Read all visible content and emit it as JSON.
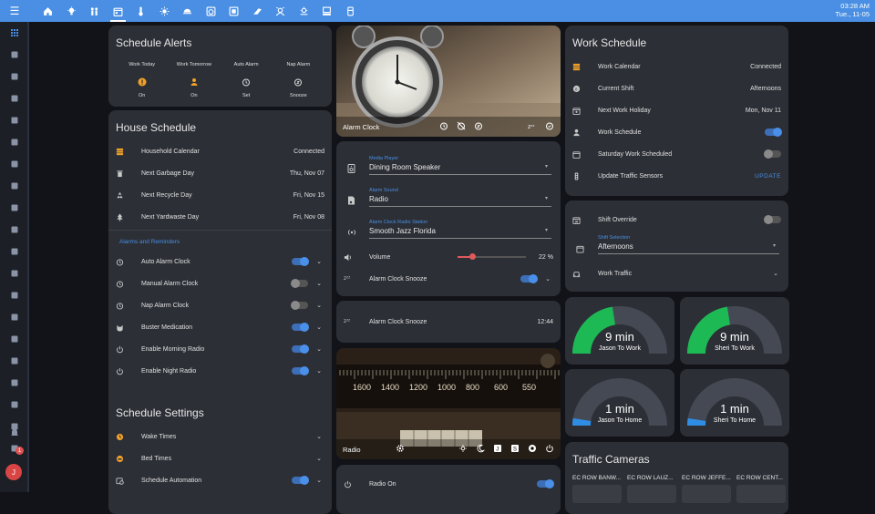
{
  "topbar": {
    "tabs": [
      "home",
      "lightbulb",
      "people",
      "calendar",
      "thermometer",
      "weather",
      "lamp",
      "washer",
      "tablet",
      "vacuum",
      "doorbell",
      "sun-cloud",
      "printer",
      "trashcan"
    ],
    "active_tab": 3,
    "time": "03:28 AM",
    "date": "Tue., 11-05"
  },
  "sidebar": {
    "items": [
      "dashboard",
      "logbook",
      "list",
      "history",
      "shield",
      "code",
      "wrench",
      "speed",
      "log",
      "calendar-grid",
      "brackets",
      "network",
      "cloud-server",
      "cloud",
      "file-code",
      "hammer",
      "router",
      "stats",
      "storage",
      "settings"
    ],
    "notification_count": "1",
    "avatar_initial": "J"
  },
  "schedule_alerts": {
    "title": "Schedule Alerts",
    "items": [
      {
        "label": "Work Today",
        "state": "On",
        "icon": "warning-icon"
      },
      {
        "label": "Work Tomorrow",
        "state": "On",
        "icon": "person-icon"
      },
      {
        "label": "Auto Alarm",
        "state": "Set",
        "icon": "alarm-icon"
      },
      {
        "label": "Nap Alarm",
        "state": "Snooze",
        "icon": "snooze-icon"
      }
    ]
  },
  "house_schedule": {
    "title": "House Schedule",
    "rows": [
      {
        "label": "Household Calendar",
        "value": "Connected"
      },
      {
        "label": "Next Garbage Day",
        "value": "Thu, Nov 07"
      },
      {
        "label": "Next Recycle Day",
        "value": "Fri, Nov 15"
      },
      {
        "label": "Next Yardwaste Day",
        "value": "Fri, Nov 08"
      }
    ],
    "section_label": "Alarms and Reminders",
    "toggles": [
      {
        "label": "Auto Alarm Clock",
        "on": true
      },
      {
        "label": "Manual Alarm Clock",
        "on": false
      },
      {
        "label": "Nap Alarm Clock",
        "on": false
      },
      {
        "label": "Buster Medication",
        "on": true
      },
      {
        "label": "Enable Morning Radio",
        "on": true
      },
      {
        "label": "Enable Night Radio",
        "on": true
      }
    ]
  },
  "schedule_settings": {
    "title": "Schedule Settings",
    "rows": [
      {
        "label": "Wake Times"
      },
      {
        "label": "Bed Times"
      },
      {
        "label": "Schedule Automation"
      }
    ]
  },
  "alarm_clock": {
    "label": "Alarm Clock"
  },
  "media": {
    "player_label": "Media Player",
    "player_value": "Dining Room Speaker",
    "sound_label": "Alarm Sound",
    "sound_value": "Radio",
    "station_label": "Alarm Clock Radio Station",
    "station_value": "Smooth Jazz Florida",
    "volume_label": "Volume",
    "volume_value": "22 %",
    "volume_level": 0.22,
    "snooze_label": "Alarm Clock Snooze"
  },
  "snooze_time": {
    "label": "Alarm Clock Snooze",
    "value": "12:44"
  },
  "radio": {
    "label": "Radio",
    "radio_on_label": "Radio On",
    "dial_numbers": [
      "1600",
      "1400",
      "1200",
      "1000",
      "800",
      "600",
      "550"
    ]
  },
  "work_schedule": {
    "title": "Work Schedule",
    "rows": [
      {
        "label": "Work Calendar",
        "value": "Connected"
      },
      {
        "label": "Current Shift",
        "value": "Afternoons"
      },
      {
        "label": "Next Work Holiday",
        "value": "Mon, Nov 11"
      }
    ],
    "toggles": [
      {
        "label": "Work Schedule",
        "on": true
      },
      {
        "label": "Saturday Work Scheduled",
        "on": false
      }
    ],
    "sensor_label": "Update Traffic Sensors",
    "sensor_action": "UPDATE"
  },
  "shift_card": {
    "override_label": "Shift Override",
    "selection_label": "Shift Selection",
    "selection_value": "Afternoons",
    "traffic_label": "Work Traffic"
  },
  "gauges": [
    {
      "value": "9 min",
      "label": "Jason To Work",
      "fraction": 0.45,
      "color": "#1db954"
    },
    {
      "value": "9 min",
      "label": "Sheri To Work",
      "fraction": 0.45,
      "color": "#1db954"
    },
    {
      "value": "1 min",
      "label": "Jason To Home",
      "fraction": 0.05,
      "color": "#2f8de4"
    },
    {
      "value": "1 min",
      "label": "Sheri To Home",
      "fraction": 0.05,
      "color": "#2f8de4"
    }
  ],
  "traffic_cameras": {
    "title": "Traffic Cameras",
    "cams": [
      "EC ROW BANW...",
      "EC ROW LAUZ...",
      "EC ROW JEFFE...",
      "EC ROW CENT..."
    ]
  }
}
